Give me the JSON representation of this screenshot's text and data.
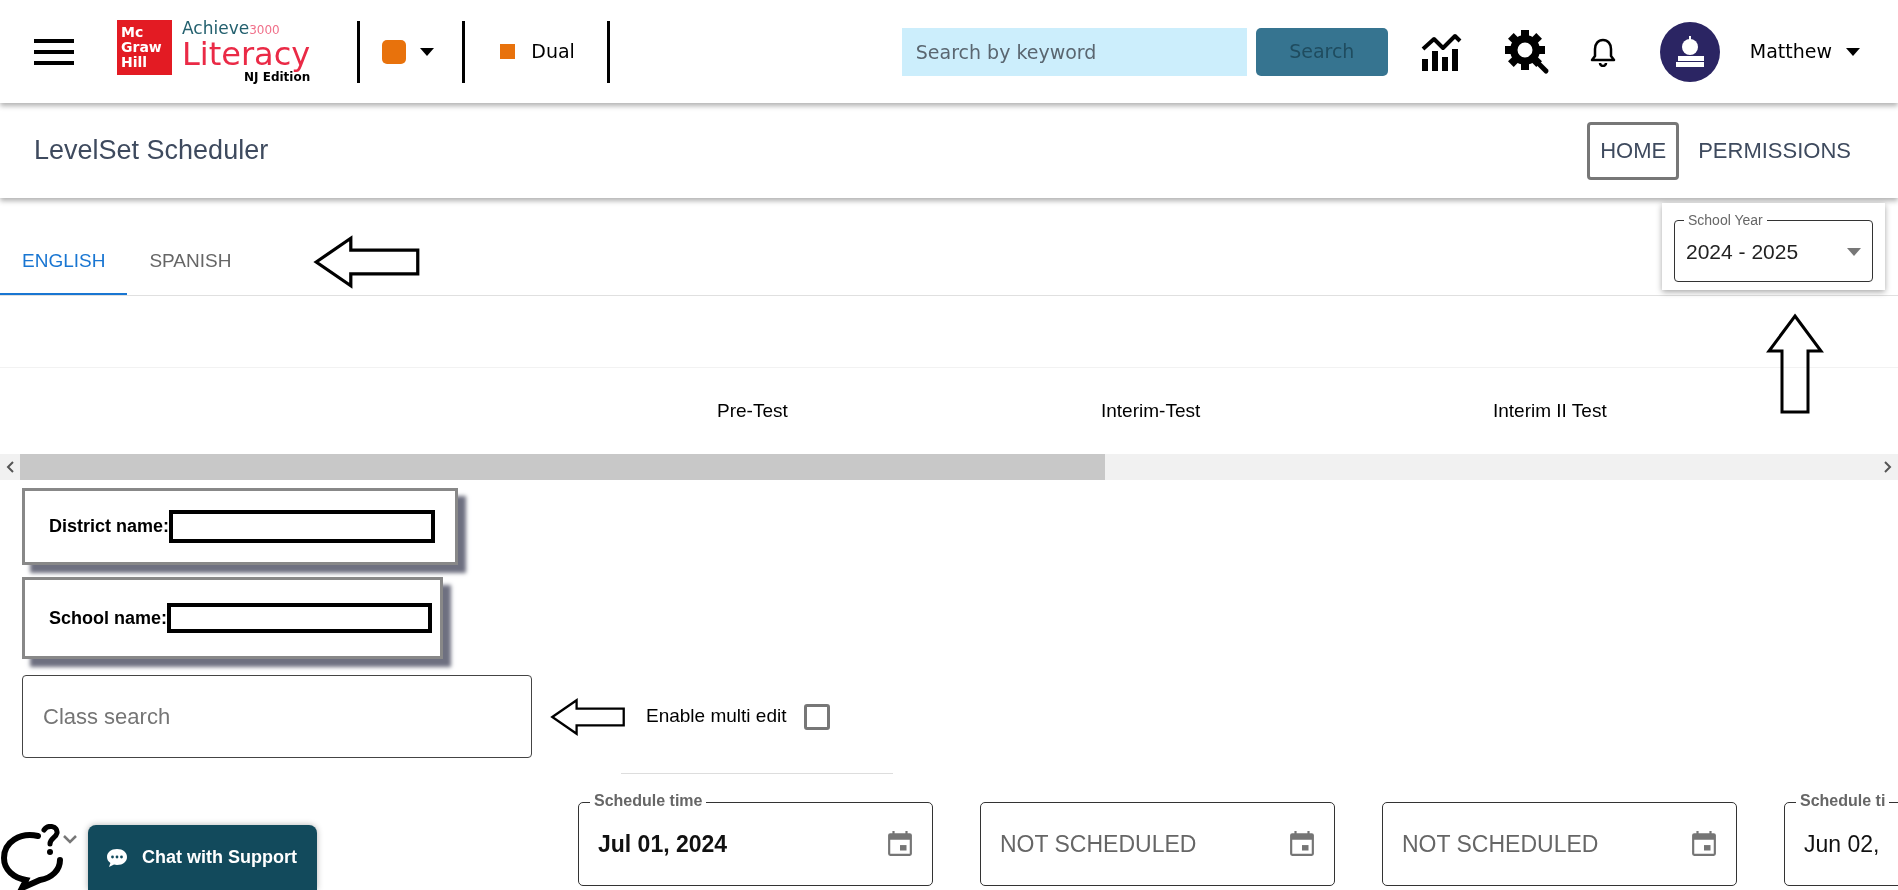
{
  "header": {
    "logo": {
      "brand_lines": [
        "Mc",
        "Graw",
        "Hill"
      ],
      "product_top": "Achieve",
      "product_top_suffix": "3000",
      "product": "Literacy",
      "edition": "NJ Edition"
    },
    "color_dropdown": {
      "color": "#e8720c"
    },
    "program": {
      "label": "Dual",
      "color": "#e8720c"
    },
    "search": {
      "placeholder": "Search by keyword",
      "button": "Search"
    },
    "user": {
      "name": "Matthew"
    }
  },
  "subheader": {
    "title": "LevelSet Scheduler",
    "nav": [
      {
        "label": "HOME",
        "selected": true
      },
      {
        "label": "PERMISSIONS",
        "selected": false
      }
    ]
  },
  "tabs": [
    {
      "label": "ENGLISH",
      "selected": true
    },
    {
      "label": "SPANISH",
      "selected": false
    }
  ],
  "school_year": {
    "label": "School Year",
    "value": "2024 - 2025"
  },
  "columns": [
    "Pre-Test",
    "Interim-Test",
    "Interim II Test"
  ],
  "info_cards": [
    {
      "label": "District name:"
    },
    {
      "label": "School name:"
    }
  ],
  "class_search": {
    "placeholder": "Class search"
  },
  "multi_edit": {
    "label": "Enable multi edit",
    "checked": false
  },
  "schedule_fields": [
    {
      "label": "Schedule time",
      "value": "Jul 01, 2024",
      "bold": true
    },
    {
      "placeholder": "NOT SCHEDULED"
    },
    {
      "placeholder": "NOT SCHEDULED"
    },
    {
      "label": "Schedule ti",
      "value": "Jun 02,",
      "bold": false
    }
  ],
  "chat": {
    "button": "Chat with Support"
  }
}
